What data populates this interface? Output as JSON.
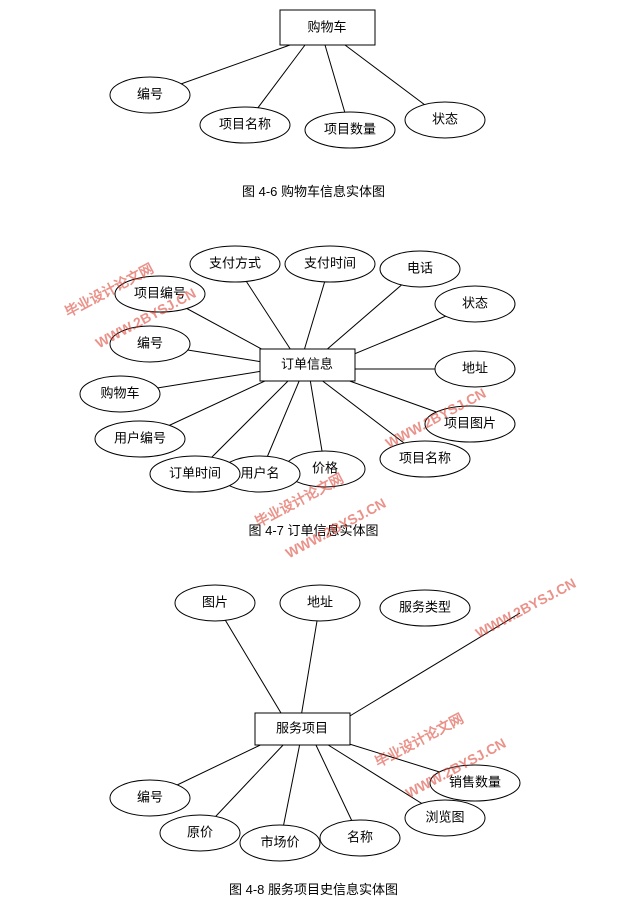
{
  "diagram1": {
    "entity": "购物车",
    "attrs": [
      "编号",
      "项目名称",
      "项目数量",
      "状态"
    ],
    "caption": "图 4-6 购物车信息实体图"
  },
  "diagram2": {
    "entity": "订单信息",
    "attrs": [
      "支付方式",
      "支付时间",
      "电话",
      "状态",
      "地址",
      "项目图片",
      "项目名称",
      "价格",
      "用户名",
      "订单时间",
      "用户编号",
      "购物车",
      "编号",
      "项目编号"
    ],
    "caption": "图 4-7 订单信息实体图"
  },
  "diagram3": {
    "entity": "服务项目",
    "attrs": [
      "图片",
      "地址",
      "服务类型",
      "销售数量",
      "浏览图",
      "名称",
      "市场价",
      "原价",
      "编号"
    ],
    "caption": "图 4-8 服务项目史信息实体图"
  },
  "watermark": {
    "text1": "毕业设计论文网",
    "text2": "WWW.2BYSJ.CN"
  }
}
